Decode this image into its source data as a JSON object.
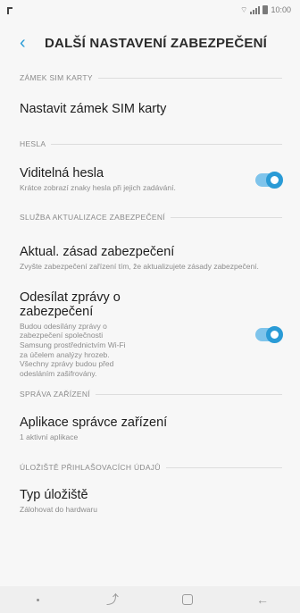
{
  "status": {
    "time": "10:00"
  },
  "header": {
    "title": "DALŠÍ NASTAVENÍ ZABEZPEČENÍ"
  },
  "sections": {
    "sim": {
      "label": "ZÁMEK SIM KARTY",
      "item_title": "Nastavit zámek SIM karty"
    },
    "passwords": {
      "label": "HESLA",
      "item_title": "Viditelná hesla",
      "item_sub": "Krátce zobrazí znaky hesla při jejich zadávání."
    },
    "security_update": {
      "label": "SLUŽBA AKTUALIZACE ZABEZPEČENÍ",
      "policy_title": "Aktual. zásad zabezpečení",
      "policy_sub": "Zvyšte zabezpečení zařízení tím, že aktualizujete zásady zabezpečení.",
      "reports_title": "Odesílat zprávy o zabezpečení",
      "reports_sub": "Budou odesílány zprávy o zabezpečení společnosti Samsung prostřednictvím Wi-Fi za účelem analýzy hrozeb. Všechny zprávy budou před odesláním zašifrovány."
    },
    "device_admin": {
      "label": "SPRÁVA ZAŘÍZENÍ",
      "item_title": "Aplikace správce zařízení",
      "item_sub": "1 aktivní aplikace"
    },
    "credential_storage": {
      "label": "ÚLOŽIŠTĚ PŘIHLAŠOVACÍCH ÚDAJŮ",
      "item_title": "Typ úložiště",
      "item_sub": "Zálohovat do hardwaru"
    }
  },
  "toggles": {
    "visible_passwords": true,
    "send_security_reports": true
  },
  "colors": {
    "accent": "#2a9bd6",
    "track": "#7fc4eb",
    "background": "#f7f7f7"
  },
  "icons": {
    "back": "chevron-left-icon",
    "nav_recent": "recent-apps-icon",
    "nav_home": "home-icon",
    "nav_back": "back-arrow-icon"
  }
}
